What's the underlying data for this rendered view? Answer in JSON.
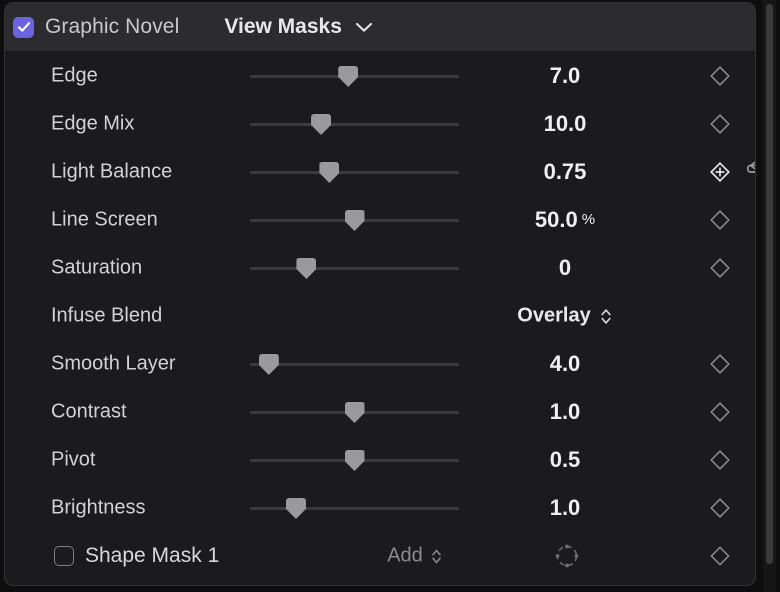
{
  "header": {
    "enabled": true,
    "checkbox_icon": "checkmark-icon",
    "title": "Graphic Novel",
    "menu_label": "View Masks",
    "menu_icon": "chevron-down-icon",
    "accent_color": "#6b63df"
  },
  "rows": [
    {
      "label": "Edge",
      "value": "7.0",
      "unit": "",
      "slider_pct": 47,
      "keyframe": "diamond",
      "reset": false
    },
    {
      "label": "Edge Mix",
      "value": "10.0",
      "unit": "",
      "slider_pct": 34,
      "keyframe": "diamond",
      "reset": false
    },
    {
      "label": "Light Balance",
      "value": "0.75",
      "unit": "",
      "slider_pct": 38,
      "keyframe": "diamond-plus",
      "reset": true
    },
    {
      "label": "Line Screen",
      "value": "50.0",
      "unit": "%",
      "slider_pct": 50,
      "keyframe": "diamond",
      "reset": false
    },
    {
      "label": "Saturation",
      "value": "0",
      "unit": "",
      "slider_pct": 27,
      "keyframe": "diamond",
      "reset": false
    },
    {
      "label": "Infuse Blend",
      "value": "Overlay",
      "unit": "",
      "slider_pct": null,
      "popup": true,
      "popup_icon": "chevron-up-down-icon",
      "keyframe": null,
      "reset": false
    },
    {
      "label": "Smooth Layer",
      "value": "4.0",
      "unit": "",
      "slider_pct": 9,
      "keyframe": "diamond",
      "reset": false
    },
    {
      "label": "Contrast",
      "value": "1.0",
      "unit": "",
      "slider_pct": 50,
      "keyframe": "diamond",
      "reset": false
    },
    {
      "label": "Pivot",
      "value": "0.5",
      "unit": "",
      "slider_pct": 50,
      "keyframe": "diamond",
      "reset": false
    },
    {
      "label": "Brightness",
      "value": "1.0",
      "unit": "",
      "slider_pct": 22,
      "keyframe": "diamond",
      "reset": false
    }
  ],
  "shape_mask": {
    "enabled": false,
    "label": "Shape Mask 1",
    "mode_label": "Add",
    "mode_icon": "chevron-up-down-icon",
    "shape_icon": "mask-circle-icon",
    "keyframe_icon": "diamond-icon"
  },
  "scrollbar": {
    "icon": "vertical-scrollbar"
  }
}
